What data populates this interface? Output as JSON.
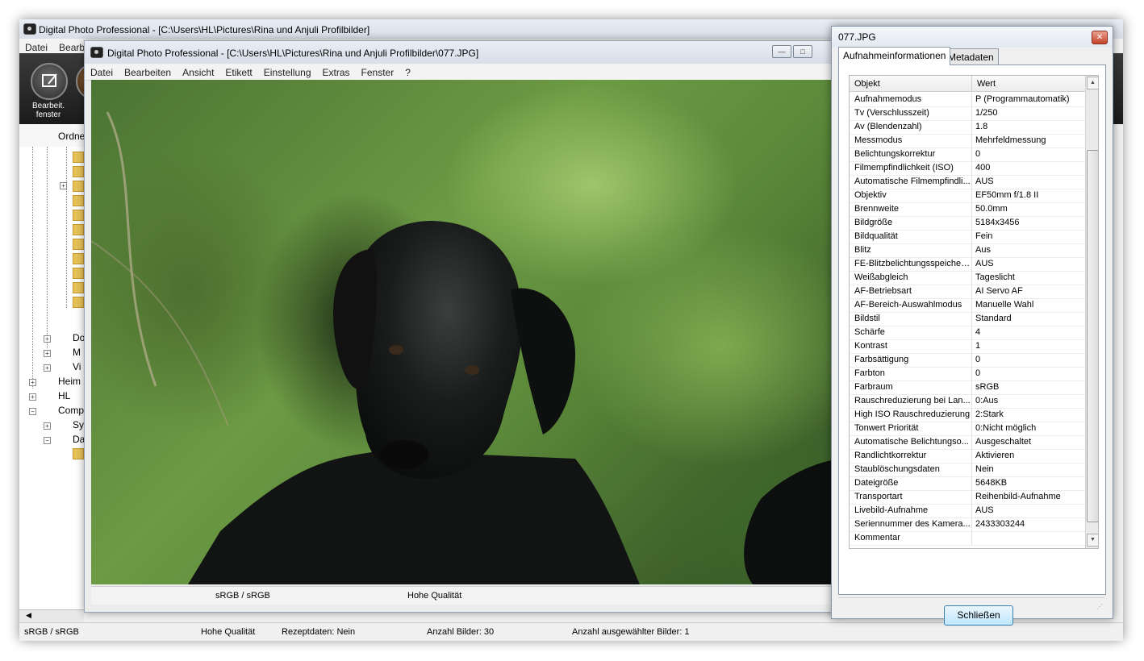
{
  "main_window": {
    "title": "Digital Photo Professional - [C:\\Users\\HL\\Pictures\\Rina und Anjuli Profilbilder]",
    "menu": [
      "Datei",
      "Bearb"
    ],
    "toolbar": {
      "edit_window_label": "Bearbeit.\nfenster",
      "folder_tab": "Ordne"
    },
    "tree": [
      "Do",
      "M",
      "Vi",
      "Heim",
      "HL",
      "Comp",
      "Sy",
      "Da"
    ],
    "status": {
      "color": "sRGB / sRGB",
      "quality": "Hohe Qualität",
      "recipe": "Rezeptdaten: Nein",
      "count": "Anzahl Bilder: 30",
      "selected": "Anzahl ausgewählter Bilder: 1"
    }
  },
  "image_window": {
    "title": "Digital Photo Professional - [C:\\Users\\HL\\Pictures\\Rina und Anjuli Profilbilder\\077.JPG]",
    "menu": [
      "Datei",
      "Bearbeiten",
      "Ansicht",
      "Etikett",
      "Einstellung",
      "Extras",
      "Fenster",
      "?"
    ],
    "status": {
      "color": "sRGB / sRGB",
      "quality": "Hohe Qualität"
    }
  },
  "info_dialog": {
    "title": "077.JPG",
    "tabs": [
      "Aufnahmeinformationen",
      "Metadaten"
    ],
    "columns": {
      "key": "Objekt",
      "value": "Wert"
    },
    "rows": [
      [
        "Aufnahmemodus",
        "P (Programmautomatik)"
      ],
      [
        "Tv (Verschlusszeit)",
        "1/250"
      ],
      [
        "Av (Blendenzahl)",
        "1.8"
      ],
      [
        "Messmodus",
        "Mehrfeldmessung"
      ],
      [
        "Belichtungskorrektur",
        "0"
      ],
      [
        "Filmempfindlichkeit (ISO)",
        "400"
      ],
      [
        "Automatische Filmempfindli...",
        "AUS"
      ],
      [
        "Objektiv",
        "EF50mm f/1.8 II"
      ],
      [
        "Brennweite",
        "50.0mm"
      ],
      [
        "Bildgröße",
        "5184x3456"
      ],
      [
        "Bildqualität",
        "Fein"
      ],
      [
        "Blitz",
        "Aus"
      ],
      [
        "FE-Blitzbelichtungsspeicher...",
        "AUS"
      ],
      [
        "Weißabgleich",
        "Tageslicht"
      ],
      [
        "AF-Betriebsart",
        "AI Servo AF"
      ],
      [
        "AF-Bereich-Auswahlmodus",
        "Manuelle  Wahl"
      ],
      [
        "Bildstil",
        "Standard"
      ],
      [
        "Schärfe",
        "4"
      ],
      [
        "Kontrast",
        "1"
      ],
      [
        "Farbsättigung",
        "0"
      ],
      [
        "Farbton",
        "0"
      ],
      [
        "Farbraum",
        "sRGB"
      ],
      [
        "Rauschreduzierung bei Lan...",
        "0:Aus"
      ],
      [
        "High ISO Rauschreduzierung",
        "2:Stark"
      ],
      [
        "Tonwert Priorität",
        "0:Nicht möglich"
      ],
      [
        "Automatische Belichtungso...",
        "Ausgeschaltet"
      ],
      [
        "Randlichtkorrektur",
        "Aktivieren"
      ],
      [
        "Staublöschungsdaten",
        "Nein"
      ],
      [
        "Dateigröße",
        "5648KB"
      ],
      [
        "Transportart",
        "Reihenbild-Aufnahme"
      ],
      [
        "Livebild-Aufnahme",
        "AUS"
      ],
      [
        "Seriennummer des Kamera...",
        "2433303244"
      ],
      [
        "Kommentar",
        ""
      ]
    ],
    "close_button": "Schließen"
  }
}
